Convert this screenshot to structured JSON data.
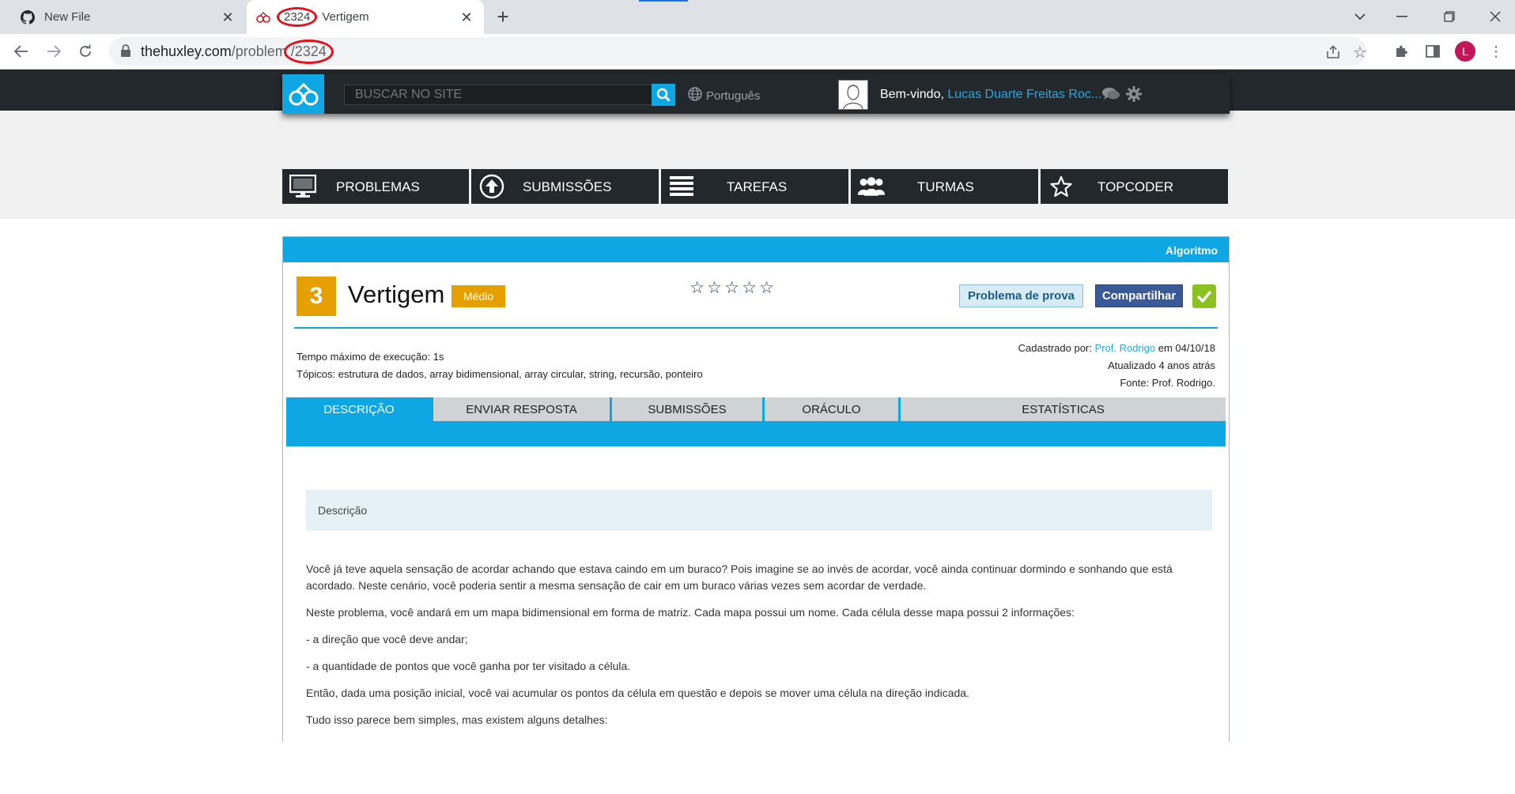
{
  "browser": {
    "tabs": [
      {
        "title": "New File"
      },
      {
        "title_highlight": "2324",
        "title": "Vertigem"
      }
    ],
    "url": {
      "domain": "thehuxley.com",
      "path": "/problem",
      "highlight": "/2324"
    },
    "profile_initial": "L"
  },
  "header": {
    "search_placeholder": "BUSCAR NO SITE",
    "language": "Português",
    "welcome": "Bem-vindo,",
    "user_name": "Lucas Duarte Freitas Roc..."
  },
  "nav": {
    "items": [
      {
        "label": "PROBLEMAS",
        "icon": "monitor-icon"
      },
      {
        "label": "SUBMISSÕES",
        "icon": "upload-icon"
      },
      {
        "label": "TAREFAS",
        "icon": "list-icon"
      },
      {
        "label": "TURMAS",
        "icon": "group-icon"
      },
      {
        "label": "TOPCODER",
        "icon": "star-icon"
      }
    ]
  },
  "problem": {
    "category": "Algoritmo",
    "level": "3",
    "title": "Vertigem",
    "difficulty": "Médio",
    "rating": {
      "value": 0,
      "max": 5
    },
    "exam_button": "Problema de prova",
    "share_button": "Compartilhar",
    "time_limit": "Tempo máximo de execução: 1s",
    "topics": "Tópicos: estrutura de dados, array bidimensional, array circular, string, recursão, ponteiro",
    "registered_by_prefix": "Cadastrado por:",
    "registered_by": "Prof. Rodrigo",
    "registered_date": "em 04/10/18",
    "updated": "Atualizado 4 anos atrás",
    "source": "Fonte: Prof. Rodrigo."
  },
  "tabs": {
    "items": [
      "DESCRIÇÃO",
      "ENVIAR RESPOSTA",
      "SUBMISSÕES",
      "ORÁCULO",
      "ESTATÍSTICAS"
    ],
    "active": 0
  },
  "description": {
    "header": "Descrição",
    "paragraphs": [
      "Você já teve aquela sensação de acordar achando que estava caindo em um buraco? Pois imagine se ao invés de acordar, você ainda continuar dormindo e sonhando que está acordado. Neste cenário, você poderia sentir a mesma sensação de cair em um buraco várias vezes sem acordar de verdade.",
      "Neste problema, você andará em um mapa bidimensional em forma de matriz. Cada mapa possui um nome. Cada célula desse mapa possui 2 informações:",
      "- a direção que você deve andar;",
      "- a quantidade de pontos que você ganha por ter visitado a célula.",
      "Então, dada uma posição inicial, você vai acumular os pontos da célula em questão e depois se mover uma célula na direção indicada.",
      "Tudo isso parece bem simples, mas existem alguns detalhes:"
    ]
  },
  "colors": {
    "accent": "#0ea7e3",
    "dark": "#23282d",
    "difficulty": "#e5a000",
    "facebook": "#3b5998",
    "solved": "#8bc220",
    "highlight_circle": "#e0141e"
  }
}
